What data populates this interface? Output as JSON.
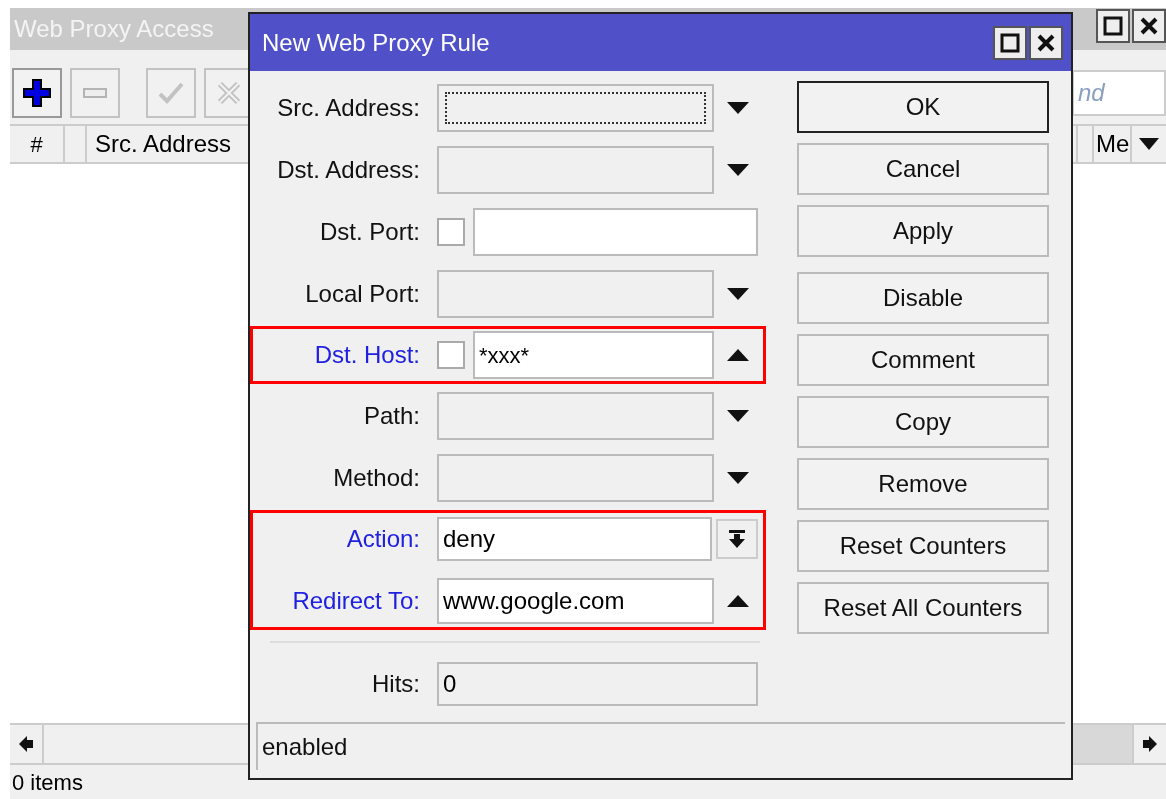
{
  "main_window": {
    "title": "Web Proxy Access",
    "toolbar": [
      {
        "kind": "add",
        "enabled": true
      },
      {
        "kind": "remove",
        "enabled": false
      },
      {
        "kind": "enable",
        "enabled": false
      },
      {
        "kind": "disable",
        "enabled": false
      }
    ],
    "find": {
      "placeholder": "nd"
    },
    "columns_left": [
      "#",
      "Src. Address"
    ],
    "columns_right": [
      "Me"
    ],
    "status": "0 items"
  },
  "dialog": {
    "title": "New Web Proxy Rule",
    "fields": [
      {
        "kind": "combo",
        "label": "Src. Address:",
        "focused": true,
        "expanded": false,
        "active": false,
        "marked": false
      },
      {
        "kind": "combo",
        "label": "Dst. Address:",
        "focused": false,
        "expanded": false,
        "active": false,
        "marked": false
      },
      {
        "kind": "negatable",
        "label": "Dst. Port:",
        "checked": false,
        "active": false,
        "marked": false
      },
      {
        "kind": "combo",
        "label": "Local Port:",
        "focused": false,
        "expanded": false,
        "active": false,
        "marked": false
      },
      {
        "kind": "negatable",
        "label": "Dst. Host:",
        "checked": false,
        "value": "*xxx*",
        "expanded": true,
        "active": true,
        "marked": true
      },
      {
        "kind": "combo",
        "label": "Path:",
        "focused": false,
        "expanded": false,
        "active": false,
        "marked": false
      },
      {
        "kind": "combo",
        "label": "Method:",
        "focused": false,
        "expanded": false,
        "active": false,
        "marked": false
      },
      {
        "kind": "select",
        "label": "Action:",
        "value": "deny",
        "active": true,
        "marked": true
      },
      {
        "kind": "text",
        "label": "Redirect To:",
        "value": "www.google.com",
        "expanded": true,
        "active": true,
        "marked": true
      }
    ],
    "readonly_fields": [
      {
        "label": "Hits:",
        "value": "0"
      }
    ],
    "button_groups": [
      {
        "buttons": [
          {
            "label": "OK",
            "default": true
          },
          {
            "label": "Cancel",
            "default": false
          },
          {
            "label": "Apply",
            "default": false
          }
        ]
      },
      {
        "buttons": [
          {
            "label": "Disable",
            "default": false
          },
          {
            "label": "Comment",
            "default": false
          },
          {
            "label": "Copy",
            "default": false
          },
          {
            "label": "Remove",
            "default": false
          },
          {
            "label": "Reset Counters",
            "default": false
          },
          {
            "label": "Reset All Counters",
            "default": false
          }
        ]
      }
    ],
    "status": "enabled"
  }
}
